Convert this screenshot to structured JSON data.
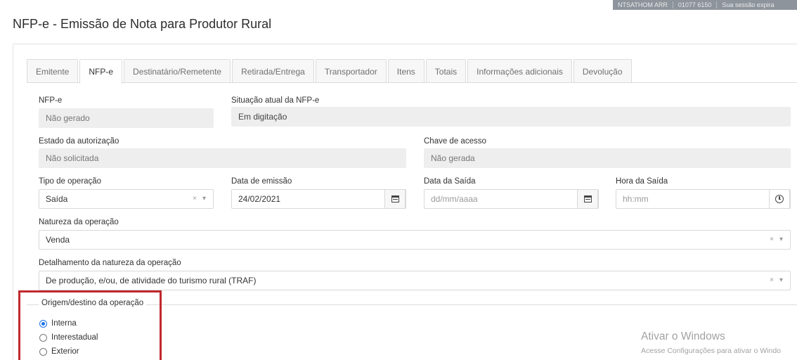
{
  "top_strip": {
    "user": "NTSATHOM ARR",
    "code": "01077 6150",
    "session": "Sua sessão expira"
  },
  "page_title": "NFP-e - Emissão de Nota para Produtor Rural",
  "tabs": [
    {
      "label": "Emitente",
      "active": false
    },
    {
      "label": "NFP-e",
      "active": true
    },
    {
      "label": "Destinatário/Remetente",
      "active": false
    },
    {
      "label": "Retirada/Entrega",
      "active": false
    },
    {
      "label": "Transportador",
      "active": false
    },
    {
      "label": "Itens",
      "active": false
    },
    {
      "label": "Totais",
      "active": false
    },
    {
      "label": "Informações adicionais",
      "active": false
    },
    {
      "label": "Devolução",
      "active": false
    }
  ],
  "form": {
    "nfpe": {
      "label": "NFP-e",
      "value": "Não gerado"
    },
    "situacao": {
      "label": "Situação atual da NFP-e",
      "value": "Em digitação"
    },
    "estado_autorizacao": {
      "label": "Estado da autorização",
      "value": "Não solicitada"
    },
    "chave_acesso": {
      "label": "Chave de acesso",
      "value": "Não gerada"
    },
    "tipo_operacao": {
      "label": "Tipo de operação",
      "value": "Saída"
    },
    "data_emissao": {
      "label": "Data de emissão",
      "value": "24/02/2021"
    },
    "data_saida": {
      "label": "Data da Saída",
      "placeholder": "dd/mm/aaaa"
    },
    "hora_saida": {
      "label": "Hora da Saída",
      "placeholder": "hh:mm"
    },
    "natureza_operacao": {
      "label": "Natureza da operação",
      "value": "Venda"
    },
    "detalhamento": {
      "label": "Detalhamento da natureza da operação",
      "value": "De produção, e/ou, de atividade do turismo rural (TRAF)"
    }
  },
  "origem_destino": {
    "legend": "Origem/destino da operação",
    "options": [
      {
        "label": "Interna",
        "selected": true
      },
      {
        "label": "Interestadual",
        "selected": false
      },
      {
        "label": "Exterior",
        "selected": false
      }
    ]
  },
  "watermark": {
    "title": "Ativar o Windows",
    "subtitle": "Acesse Configurações para ativar o Windo"
  },
  "colors": {
    "highlight_border": "#c0282e",
    "radio_selected": "#1a73e8",
    "readonly_bg": "#eeeeee"
  },
  "icons": {
    "clear": "×",
    "dropdown": "▾"
  }
}
